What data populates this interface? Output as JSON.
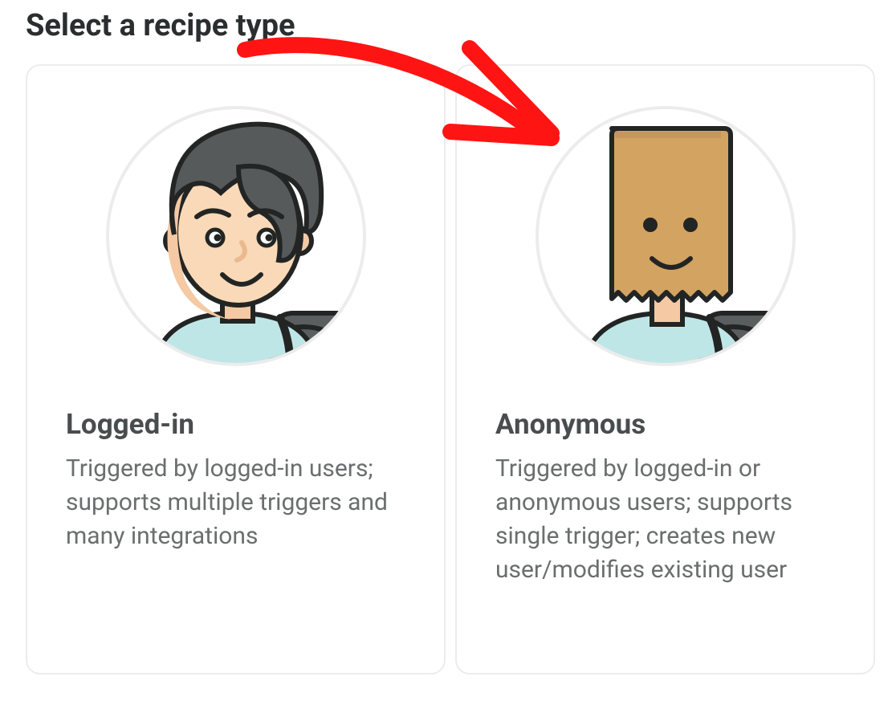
{
  "header": {
    "title": "Select a recipe type"
  },
  "cards": [
    {
      "icon": "logged-in-user-icon",
      "title": "Logged-in",
      "description": "Triggered by logged-in users; supports multiple triggers and many integrations"
    },
    {
      "icon": "anonymous-user-icon",
      "title": "Anonymous",
      "description": "Triggered by logged-in or anonymous users; supports single trigger; creates new user/modifies existing user"
    }
  ],
  "annotation": {
    "color": "#ff1414",
    "type": "arrow",
    "points_to": "card-anonymous"
  }
}
